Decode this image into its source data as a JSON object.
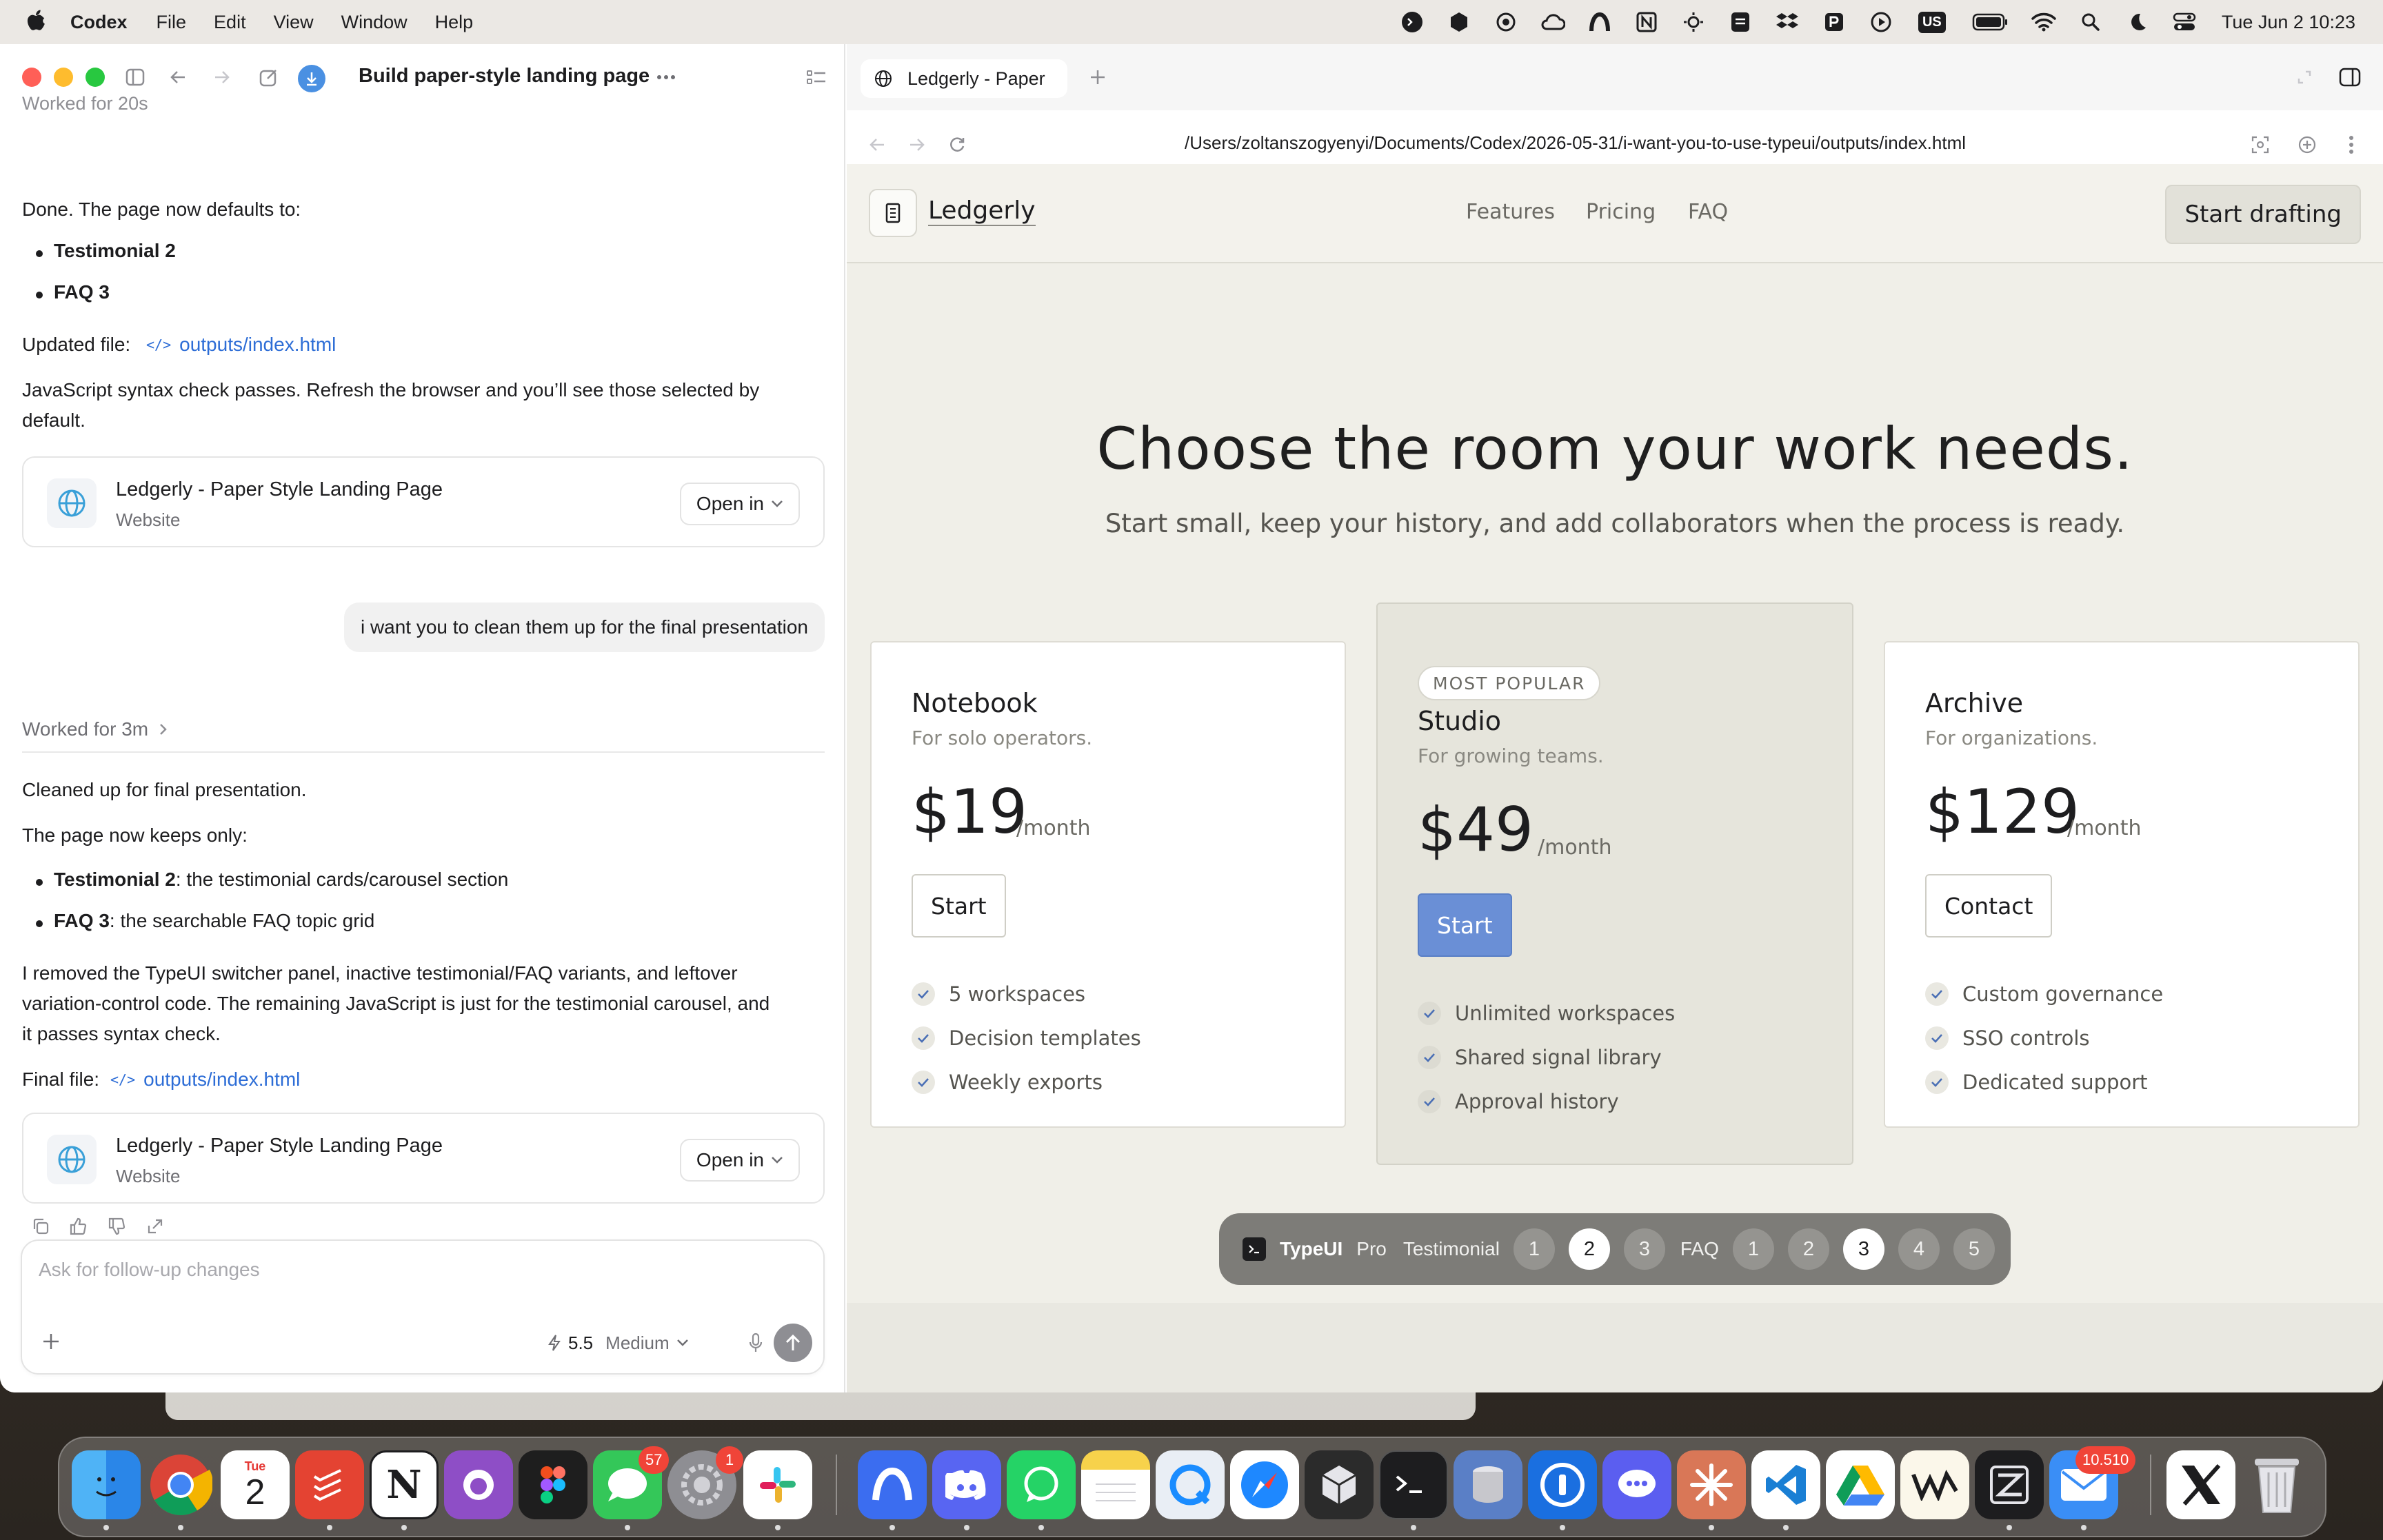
{
  "menubar": {
    "app": "Codex",
    "items": [
      "File",
      "Edit",
      "View",
      "Window",
      "Help"
    ],
    "clock": "Tue Jun 2  10:23",
    "input_badge": "US"
  },
  "left": {
    "title": "Build paper-style landing page",
    "worked_earlier": "Worked for 20s",
    "msg1": "Done. The page now defaults to:",
    "bullet1": "Testimonial 2",
    "bullet2": "FAQ 3",
    "updated_label": "Updated file:",
    "updated_link": "outputs/index.html",
    "syntax1": "JavaScript syntax check passes. Refresh the browser and you’ll see those selected by",
    "syntax2": "default.",
    "card": {
      "title": "Ledgerly - Paper Style Landing Page",
      "sub": "Website",
      "open": "Open in"
    },
    "user_msg": "i want you to clean them up for the final presentation",
    "worked": "Worked for 3m",
    "clean1": "Cleaned up for final presentation.",
    "clean2": "The page now keeps only:",
    "b3_bold": "Testimonial 2",
    "b3_rest": ": the testimonial cards/carousel section",
    "b4_bold": "FAQ 3",
    "b4_rest": ": the searchable FAQ topic grid",
    "removed1": "I removed the TypeUI switcher panel, inactive testimonial/FAQ variants, and leftover",
    "removed2": "variation-control code. The remaining JavaScript is just for the testimonial carousel, and",
    "removed3": "it passes syntax check.",
    "final_label": "Final file:",
    "final_link": "outputs/index.html",
    "composer_placeholder": "Ask for follow-up changes",
    "model_version": "5.5",
    "model_effort": "Medium"
  },
  "browser": {
    "tab_title": "Ledgerly - Paper",
    "url": "/Users/zoltanszogyenyi/Documents/Codex/2026-05-31/i-want-you-to-use-typeui/outputs/index.html"
  },
  "site": {
    "brand": "Ledgerly",
    "nav": [
      "Features",
      "Pricing",
      "FAQ"
    ],
    "cta": "Start drafting",
    "headline": "Choose the room your work needs.",
    "subheadline": "Start small, keep your history, and add collaborators when the process is ready.",
    "plans": [
      {
        "name": "Notebook",
        "desc": "For solo operators.",
        "price": "$19",
        "unit": "/month",
        "button": "Start",
        "features": [
          "5 workspaces",
          "Decision templates",
          "Weekly exports"
        ]
      },
      {
        "badge": "MOST POPULAR",
        "name": "Studio",
        "desc": "For growing teams.",
        "price": "$49",
        "unit": "/month",
        "button": "Start",
        "features": [
          "Unlimited workspaces",
          "Shared signal library",
          "Approval history"
        ]
      },
      {
        "name": "Archive",
        "desc": "For organizations.",
        "price": "$129",
        "unit": "/month",
        "button": "Contact",
        "features": [
          "Custom governance",
          "SSO controls",
          "Dedicated support"
        ]
      }
    ]
  },
  "switcher": {
    "brand": "TypeUI",
    "pro": "Pro",
    "testimonial_label": "Testimonial",
    "testimonial_options": [
      "1",
      "2",
      "3"
    ],
    "testimonial_selected": "2",
    "faq_label": "FAQ",
    "faq_options": [
      "1",
      "2",
      "3",
      "4",
      "5"
    ],
    "faq_selected": "3"
  },
  "dock": {
    "calendar_month": "Tue",
    "calendar_day": "2",
    "messages_badge": "57",
    "settings_badge": "1",
    "mail_badge": "10.510"
  },
  "colors": {
    "link": "#2d6dd6",
    "primary_button": "#6a8fd6",
    "page_bg": "#f0efe8"
  }
}
